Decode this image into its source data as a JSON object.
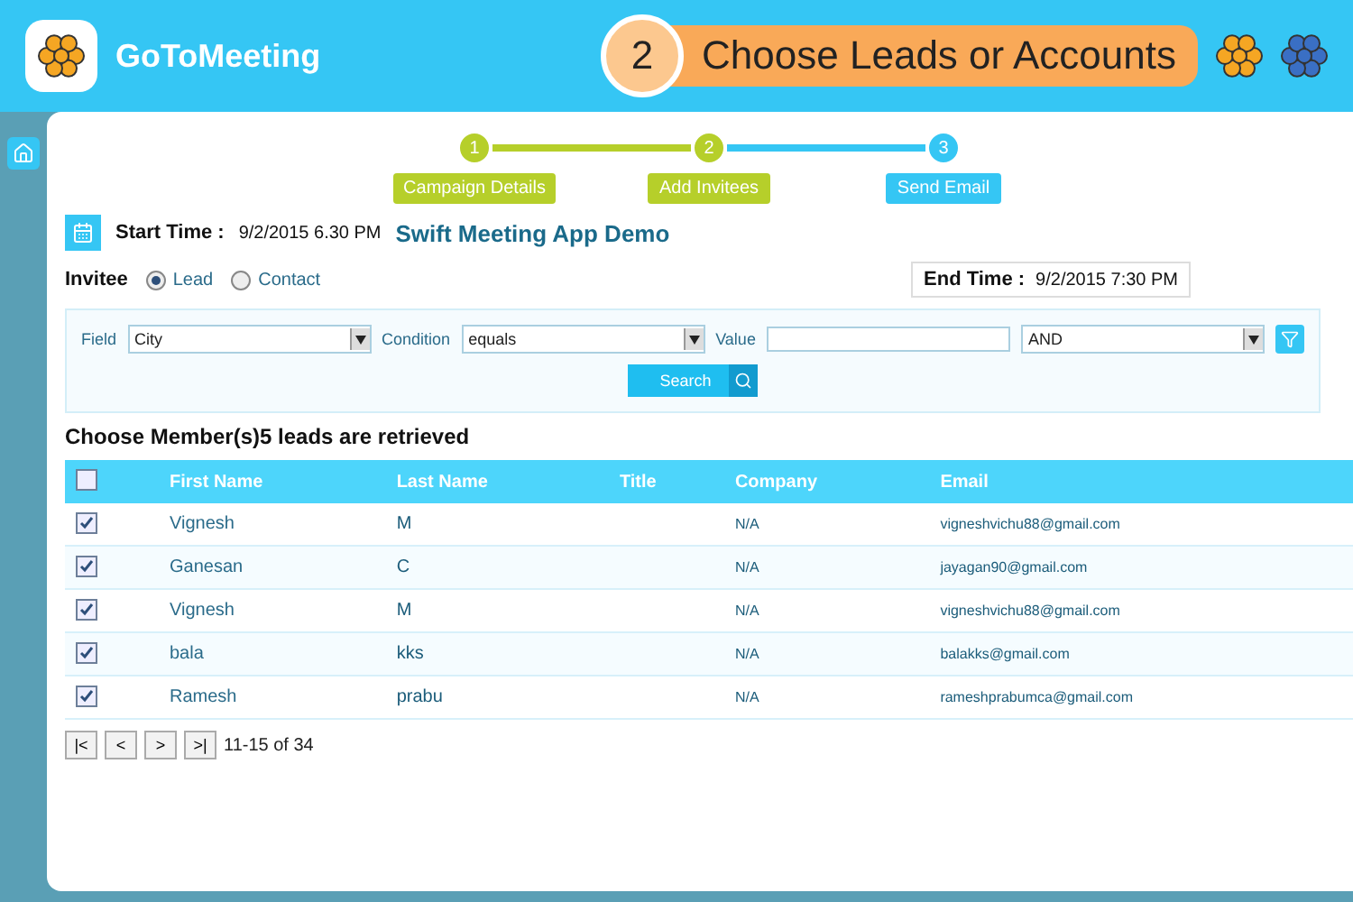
{
  "brand": {
    "name": "GoToMeeting"
  },
  "callout": {
    "number": "2",
    "text": "Choose Leads or Accounts"
  },
  "steps": [
    {
      "number": "1",
      "label": "Campaign Details",
      "completed": true
    },
    {
      "number": "2",
      "label": "Add Invitees",
      "completed": true
    },
    {
      "number": "3",
      "label": "Send Email",
      "completed": false
    }
  ],
  "meeting": {
    "title": "Swift Meeting App Demo",
    "start_label": "Start Time :",
    "start_value": "9/2/2015 6.30 PM",
    "end_label": "End Time :",
    "end_value": "9/2/2015 7:30 PM"
  },
  "invitee": {
    "label": "Invitee",
    "options": [
      {
        "label": "Lead",
        "selected": true
      },
      {
        "label": "Contact",
        "selected": false
      }
    ]
  },
  "filter": {
    "field_label": "Field",
    "field_value": "City",
    "condition_label": "Condition",
    "condition_value": "equals",
    "value_label": "Value",
    "operator": "AND",
    "search_button": "Search"
  },
  "heading": {
    "title": "Choose Member(s)",
    "count": "5 leads are retrieved"
  },
  "table": {
    "select_all": false,
    "columns": [
      "First Name",
      "Last Name",
      "Title",
      "Company",
      "Email"
    ],
    "rows": [
      {
        "checked": true,
        "cells": [
          "Vignesh",
          "M",
          "",
          "N/A",
          "vigneshvichu88@gmail.com"
        ]
      },
      {
        "checked": true,
        "cells": [
          "Ganesan",
          "C",
          "",
          "N/A",
          "jayagan90@gmail.com"
        ]
      },
      {
        "checked": true,
        "cells": [
          "Vignesh",
          "M",
          "",
          "N/A",
          "vigneshvichu88@gmail.com"
        ]
      },
      {
        "checked": true,
        "cells": [
          "bala",
          "kks",
          "",
          "N/A",
          "balakks@gmail.com"
        ]
      },
      {
        "checked": true,
        "cells": [
          "Ramesh",
          "prabu",
          "",
          "N/A",
          "rameshprabumca@gmail.com"
        ]
      }
    ]
  },
  "pager": {
    "buttons": [
      "|<",
      "<",
      ">",
      ">|"
    ],
    "range": "11-15 of 34"
  }
}
